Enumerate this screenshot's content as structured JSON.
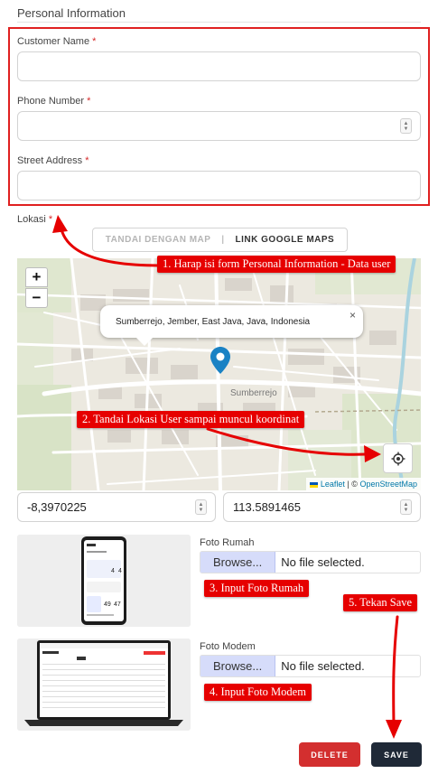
{
  "section": {
    "title": "Personal Information"
  },
  "form": {
    "customer_name": {
      "label": "Customer Name",
      "required_mark": "*",
      "value": ""
    },
    "phone_number": {
      "label": "Phone Number",
      "required_mark": "*",
      "value": ""
    },
    "street_address": {
      "label": "Street Address",
      "required_mark": "*",
      "value": ""
    }
  },
  "location": {
    "label": "Lokasi",
    "required_mark": "*",
    "toggle": {
      "option_map": "TANDAI DENGAN MAP",
      "separator": "|",
      "option_link": "LINK GOOGLE MAPS",
      "active": "option_link"
    },
    "map": {
      "zoom_in": "+",
      "zoom_out": "−",
      "popup_text": "Sumberrejo, Jember, East Java, Java, Indonesia",
      "popup_close": "×",
      "place_label": "Sumberrejo",
      "attribution": {
        "leaflet": "Leaflet",
        "separator": "| ©",
        "osm": "OpenStreetMap"
      }
    },
    "latitude": "-8,3970225",
    "longitude": "113.5891465"
  },
  "photos": {
    "house": {
      "label": "Foto Rumah",
      "browse": "Browse...",
      "status": "No file selected."
    },
    "modem": {
      "label": "Foto Modem",
      "browse": "Browse...",
      "status": "No file selected."
    }
  },
  "actions": {
    "delete": "DELETE",
    "save": "SAVE"
  },
  "annotations": {
    "step1": "1. Harap isi form Personal Information - Data user",
    "step2": "2. Tandai Lokasi User sampai muncul koordinat",
    "step3": "3. Input Foto Rumah",
    "step4": "4. Input Foto Modem",
    "step5": "5. Tekan Save"
  },
  "colors": {
    "annotation_red": "#e60000",
    "delete_red": "#d32f2f",
    "save_dark": "#1f2937",
    "browse_blue": "#d6dcfa",
    "map_pin": "#1a82c4"
  }
}
